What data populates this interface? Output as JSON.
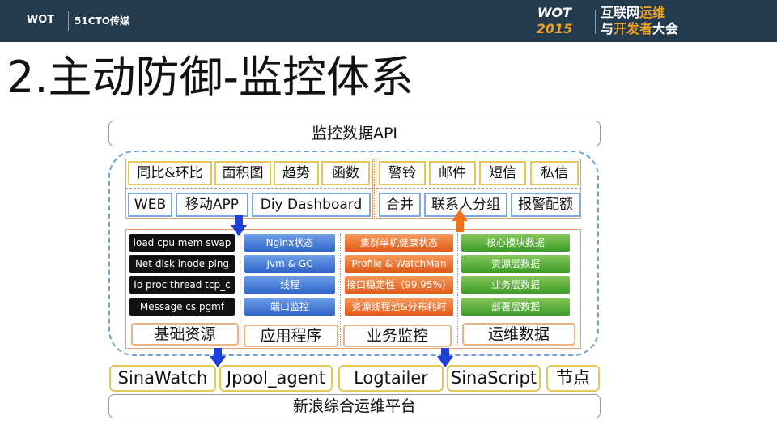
{
  "header": {
    "logo_left": "WOT",
    "logo_partner": "51CTO传媒",
    "event_wot": "WOT",
    "event_year": "2015",
    "event_name_1": "互联网",
    "event_name_2": "运维",
    "event_name_3": "与",
    "event_name_4": "开发者",
    "event_name_5": "大会"
  },
  "slide": {
    "title": "2.主动防御-监控体系",
    "top_bar": "监控数据API",
    "row1_left": [
      "同比&环比",
      "面积图",
      "趋势",
      "函数"
    ],
    "row1_right": [
      "警铃",
      "邮件",
      "短信",
      "私信"
    ],
    "row2_left": [
      "WEB",
      "移动APP",
      "Diy Dashboard"
    ],
    "row2_right": [
      "合并",
      "联系人分组",
      "报警配额"
    ],
    "col1": [
      "load cpu mem swap",
      "Net disk inode ping",
      "Io proc thread tcp_c",
      "Message cs pgmf"
    ],
    "col2": [
      "Nginx状态",
      "Jvm & GC",
      "线程",
      "端口监控"
    ],
    "col3": [
      "集群单机健康状态",
      "Profile & WatchMan",
      "接口稳定性（99.95%）",
      "资源线程池&分布耗时"
    ],
    "col4": [
      "核心模块数据",
      "资源层数据",
      "业务层数据",
      "部署层数据"
    ],
    "categories": [
      "基础资源",
      "应用程序",
      "业务监控",
      "运维数据"
    ],
    "collectors": [
      "SinaWatch",
      "Jpool_agent",
      "Logtailer",
      "SinaScript",
      "节点"
    ],
    "platform": "新浪综合运维平台"
  }
}
